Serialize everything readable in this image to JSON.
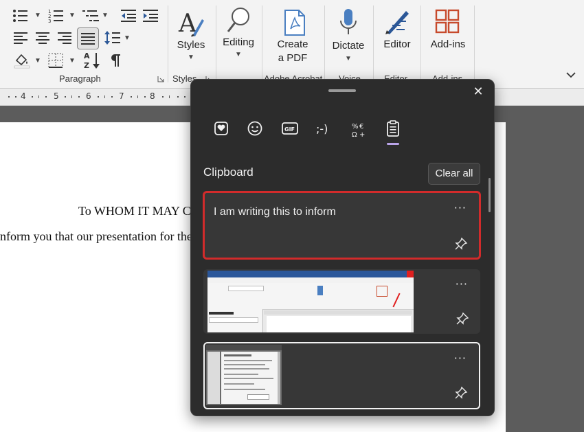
{
  "ribbon": {
    "groups": {
      "paragraph": "Paragraph",
      "styles": "Styles",
      "adobe": "Adobe Acrobat",
      "voice": "Voice",
      "editor": "Editor",
      "addins": "Add-ins"
    },
    "buttons": {
      "styles": "Styles",
      "editing": "Editing",
      "create_pdf_l1": "Create",
      "create_pdf_l2": "a PDF",
      "dictate": "Dictate",
      "editor": "Editor",
      "addins": "Add-ins"
    },
    "accent": "#c74a2c"
  },
  "ruler": {
    "numbers": [
      "4",
      "5",
      "6",
      "7",
      "8"
    ]
  },
  "document": {
    "line1": "To WHOM IT MAY C",
    "line2": "nform you that our presentation for the"
  },
  "clipboard": {
    "title": "Clipboard",
    "clear_all": "Clear all",
    "tabs": [
      "favorites-icon",
      "emoji-icon",
      "gif-icon",
      "kaomoji-icon",
      "symbols-icon",
      "clipboard-icon"
    ],
    "items": [
      {
        "text": "I am writing this to inform",
        "type": "text",
        "highlighted": true
      },
      {
        "type": "image",
        "description_hidden": true
      },
      {
        "type": "image",
        "selected": true
      }
    ],
    "more": "···",
    "highlight_color": "#d22b2b"
  }
}
